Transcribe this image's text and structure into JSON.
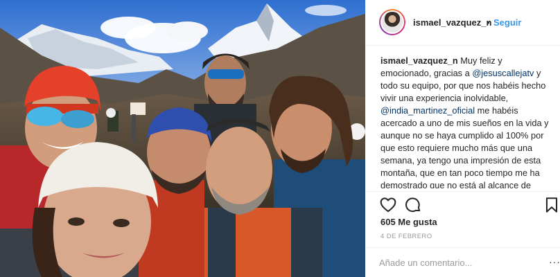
{
  "photo": {
    "alt": "group selfie in front of Himalayan peaks"
  },
  "header": {
    "username": "ismael_vazquez_n",
    "separator": "•",
    "follow_label": "Seguir"
  },
  "caption": {
    "author": "ismael_vazquez_n",
    "part1": " Muy feliz y emocionado, gracias a ",
    "mention1": "@jesuscallejatv",
    "part2": " y todo su equipo, por que nos habéis hecho vivir una experiencia inolvidable, ",
    "mention2": "@india_martinez_oficial",
    "part3": " me habéis acercado a uno de mis sueños en la vida y aunque no se haya cumplido al 100% por que esto requiere mucho más que una semana, ya tengo una impresión de esta montaña, que en tan poco tiempo me ha demostrado que no está al alcance de cualquiera, que no se le"
  },
  "actions": {
    "like_icon": "heart-icon",
    "comment_icon": "comment-icon",
    "save_icon": "bookmark-icon"
  },
  "likes_text": "605 Me gusta",
  "date_text": "4 DE FEBRERO",
  "comment": {
    "placeholder": "Añade un comentario...",
    "more_label": "···"
  },
  "colors": {
    "link": "#3897f0",
    "mention": "#003569",
    "muted": "#999999",
    "text": "#262626"
  }
}
